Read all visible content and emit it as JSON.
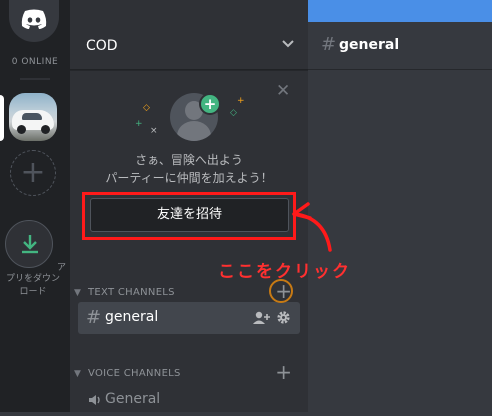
{
  "app": {
    "online_label": "0 ONLINE",
    "download_label_line1": "ア",
    "download_label_line2": "プリをダウン\nロード"
  },
  "server": {
    "name": "COD"
  },
  "invite": {
    "text": "さぁ、冒険へ出よう\nパーティーに仲間を加えよう！",
    "button_label": "友達を招待"
  },
  "annotation": {
    "click_here": "ここをクリック",
    "color": "#ff1a1a"
  },
  "sections": {
    "text_channels": "TEXT CHANNELS",
    "voice_channels": "VOICE CHANNELS"
  },
  "channels": {
    "text": [
      {
        "name": "general"
      }
    ],
    "voice": [
      {
        "name": "General"
      }
    ]
  },
  "chat": {
    "channel": "general"
  },
  "icons": [
    "discord-logo-icon",
    "plus-icon",
    "download-icon",
    "close-icon",
    "chevron-down-icon",
    "hash-icon",
    "add-member-icon",
    "gear-icon",
    "speaker-icon"
  ],
  "colors": {
    "rail": "#202225",
    "sidebar": "#2f3136",
    "chat": "#36393f",
    "accent_green": "#43b581",
    "top_bar": "#4a8fe7"
  }
}
